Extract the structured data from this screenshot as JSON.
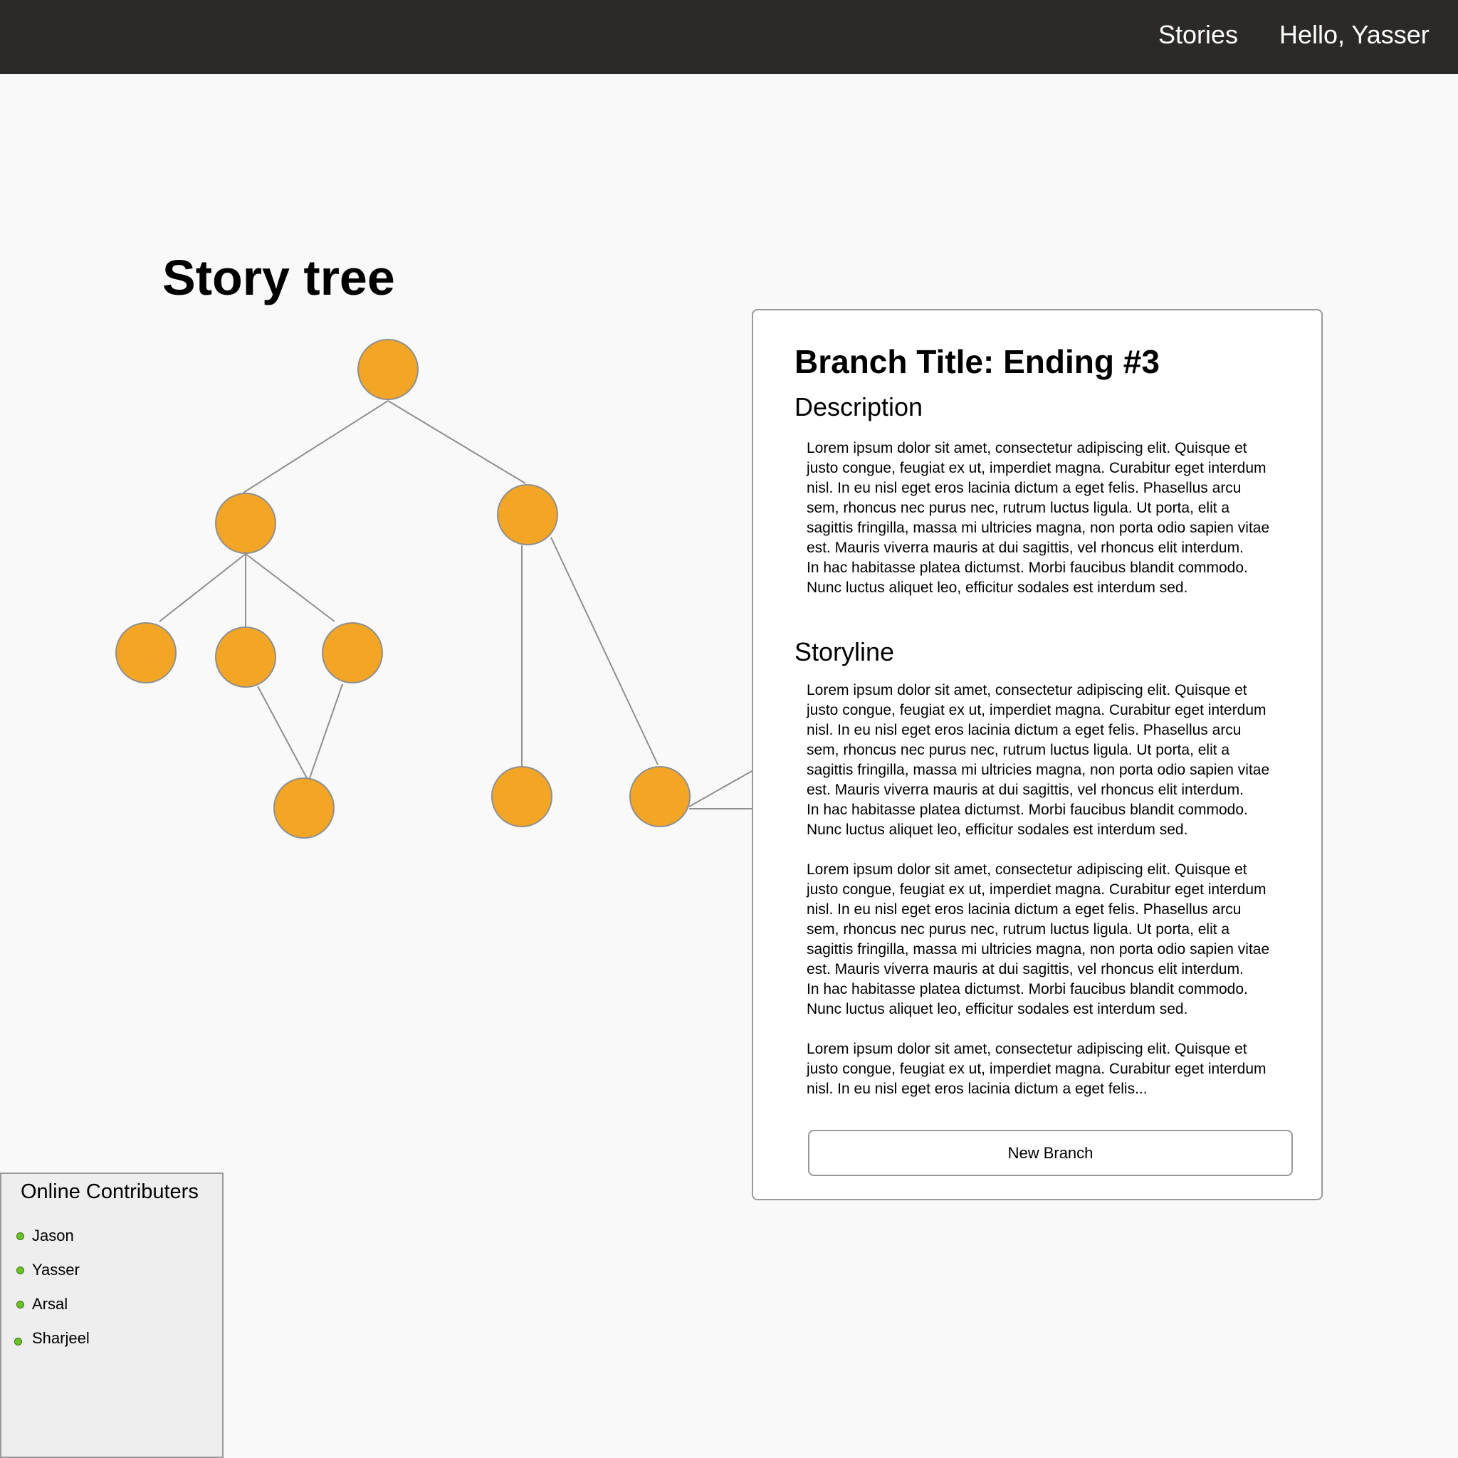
{
  "nav": {
    "stories_label": "Stories",
    "greeting": "Hello, Yasser"
  },
  "page": {
    "title": "Story tree"
  },
  "branch_panel": {
    "title": "Branch Title: Ending #3",
    "description_heading": "Description",
    "description_text": "Lorem ipsum dolor sit amet, consectetur adipiscing elit. Quisque et\njusto congue, feugiat ex ut, imperdiet magna. Curabitur eget interdum\n nisl. In eu nisl eget eros lacinia dictum a eget felis. Phasellus arcu\nsem, rhoncus nec purus nec, rutrum luctus ligula. Ut porta, elit a\nsagittis fringilla, massa mi ultricies magna, non porta odio sapien vitae\n est. Mauris viverra mauris at dui sagittis, vel rhoncus elit interdum.\nIn hac habitasse platea dictumst. Morbi faucibus blandit commodo.\nNunc luctus aliquet leo, efficitur sodales est interdum sed.",
    "storyline_heading": "Storyline",
    "storyline_paragraphs": [
      "Lorem ipsum dolor sit amet, consectetur adipiscing elit. Quisque et\njusto congue, feugiat ex ut, imperdiet magna. Curabitur eget interdum\n nisl. In eu nisl eget eros lacinia dictum a eget felis. Phasellus arcu\nsem, rhoncus nec purus nec, rutrum luctus ligula. Ut porta, elit a\nsagittis fringilla, massa mi ultricies magna, non porta odio sapien vitae\n est. Mauris viverra mauris at dui sagittis, vel rhoncus elit interdum.\nIn hac habitasse platea dictumst. Morbi faucibus blandit commodo.\nNunc luctus aliquet leo, efficitur sodales est interdum sed.",
      "Lorem ipsum dolor sit amet, consectetur adipiscing elit. Quisque et\njusto congue, feugiat ex ut, imperdiet magna. Curabitur eget interdum\n nisl. In eu nisl eget eros lacinia dictum a eget felis. Phasellus arcu\nsem, rhoncus nec purus nec, rutrum luctus ligula. Ut porta, elit a\nsagittis fringilla, massa mi ultricies magna, non porta odio sapien vitae\n est. Mauris viverra mauris at dui sagittis, vel rhoncus elit interdum.\nIn hac habitasse platea dictumst. Morbi faucibus blandit commodo.\nNunc luctus aliquet leo, efficitur sodales est interdum sed.",
      "Lorem ipsum dolor sit amet, consectetur adipiscing elit. Quisque et\njusto congue, feugiat ex ut, imperdiet magna. Curabitur eget interdum\n nisl. In eu nisl eget eros lacinia dictum a eget felis..."
    ],
    "new_branch_label": "New Branch"
  },
  "contributors": {
    "title": "Online Contributers",
    "names": [
      "Jason",
      "Yasser",
      "Arsal",
      "Sharjeel"
    ]
  },
  "colors": {
    "node_fill": "#f3a626",
    "online_dot": "#6cc12a",
    "topbar": "#2b2a28"
  }
}
